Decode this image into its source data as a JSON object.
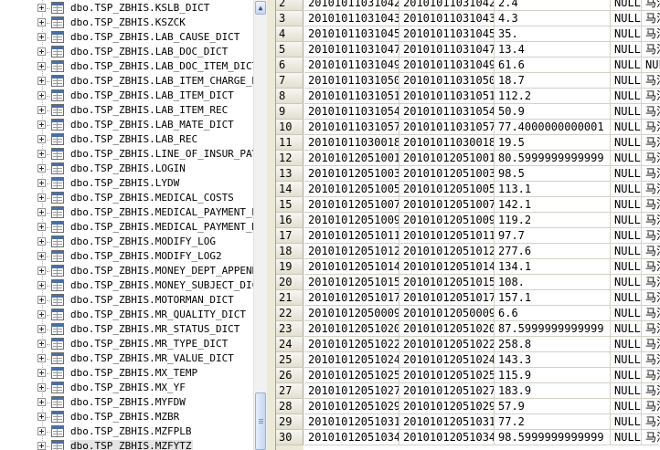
{
  "tree": {
    "items": [
      {
        "label": "dbo.TSP_ZBHIS.KSLB_DICT"
      },
      {
        "label": "dbo.TSP_ZBHIS.KSZCK"
      },
      {
        "label": "dbo.TSP_ZBHIS.LAB_CAUSE_DICT"
      },
      {
        "label": "dbo.TSP_ZBHIS.LAB_DOC_DICT"
      },
      {
        "label": "dbo.TSP_ZBHIS.LAB_DOC_ITEM_DICT"
      },
      {
        "label": "dbo.TSP_ZBHIS.LAB_ITEM_CHARGE_DIC"
      },
      {
        "label": "dbo.TSP_ZBHIS.LAB_ITEM_DICT"
      },
      {
        "label": "dbo.TSP_ZBHIS.LAB_ITEM_REC"
      },
      {
        "label": "dbo.TSP_ZBHIS.LAB_MATE_DICT"
      },
      {
        "label": "dbo.TSP_ZBHIS.LAB_REC"
      },
      {
        "label": "dbo.TSP_ZBHIS.LINE_OF_INSUR_PAYME"
      },
      {
        "label": "dbo.TSP_ZBHIS.LOGIN"
      },
      {
        "label": "dbo.TSP_ZBHIS.LYDW"
      },
      {
        "label": "dbo.TSP_ZBHIS.MEDICAL_COSTS"
      },
      {
        "label": "dbo.TSP_ZBHIS.MEDICAL_PAYMENT_DET"
      },
      {
        "label": "dbo.TSP_ZBHIS.MEDICAL_PAYMENT_MAS"
      },
      {
        "label": "dbo.TSP_ZBHIS.MODIFY_LOG"
      },
      {
        "label": "dbo.TSP_ZBHIS.MODIFY_LOG2"
      },
      {
        "label": "dbo.TSP_ZBHIS.MONEY_DEPT_APPENDED"
      },
      {
        "label": "dbo.TSP_ZBHIS.MONEY_SUBJECT_DICT"
      },
      {
        "label": "dbo.TSP_ZBHIS.MOTORMAN_DICT"
      },
      {
        "label": "dbo.TSP_ZBHIS.MR_QUALITY_DICT"
      },
      {
        "label": "dbo.TSP_ZBHIS.MR_STATUS_DICT"
      },
      {
        "label": "dbo.TSP_ZBHIS.MR_TYPE_DICT"
      },
      {
        "label": "dbo.TSP_ZBHIS.MR_VALUE_DICT"
      },
      {
        "label": "dbo.TSP_ZBHIS.MX_TEMP"
      },
      {
        "label": "dbo.TSP_ZBHIS.MX_YF"
      },
      {
        "label": "dbo.TSP_ZBHIS.MYFDW"
      },
      {
        "label": "dbo.TSP_ZBHIS.MZBR"
      },
      {
        "label": "dbo.TSP_ZBHIS.MZFPLB"
      },
      {
        "label": "dbo.TSP_ZBHIS.MZFYTZ"
      }
    ],
    "selected_index": 30
  },
  "scrollbar": {
    "up_arrow_icon": "chevron-up-icon"
  },
  "grid": {
    "rows": [
      {
        "n": "2",
        "a": "20101011031042",
        "b": "20101011031042",
        "c": "2.4",
        "d": "NULL",
        "e": "马法"
      },
      {
        "n": "3",
        "a": "20101011031043",
        "b": "20101011031043",
        "c": "4.3",
        "d": "NULL",
        "e": "马法"
      },
      {
        "n": "4",
        "a": "20101011031045",
        "b": "20101011031045",
        "c": "35.",
        "d": "NULL",
        "e": "马法"
      },
      {
        "n": "5",
        "a": "20101011031047",
        "b": "20101011031047",
        "c": "13.4",
        "d": "NULL",
        "e": "马法"
      },
      {
        "n": "6",
        "a": "20101011031049",
        "b": "20101011031049",
        "c": "61.6",
        "d": "NULL",
        "e": "NULL"
      },
      {
        "n": "7",
        "a": "20101011031050",
        "b": "20101011031050",
        "c": "18.7",
        "d": "NULL",
        "e": "马法"
      },
      {
        "n": "8",
        "a": "20101011031051",
        "b": "20101011031051",
        "c": "112.2",
        "d": "NULL",
        "e": "马法"
      },
      {
        "n": "9",
        "a": "20101011031054",
        "b": "20101011031054",
        "c": "50.9",
        "d": "NULL",
        "e": "马法"
      },
      {
        "n": "10",
        "a": "20101011031057",
        "b": "20101011031057",
        "c": "77.4000000000001",
        "d": "NULL",
        "e": "马法"
      },
      {
        "n": "11",
        "a": "20101011030018",
        "b": "20101011030018",
        "c": "19.5",
        "d": "NULL",
        "e": "马法"
      },
      {
        "n": "12",
        "a": "20101012051001",
        "b": "20101012051001",
        "c": "80.5999999999999",
        "d": "NULL",
        "e": "马法"
      },
      {
        "n": "13",
        "a": "20101012051003",
        "b": "20101012051003",
        "c": "98.5",
        "d": "NULL",
        "e": "马法"
      },
      {
        "n": "14",
        "a": "20101012051005",
        "b": "20101012051005",
        "c": "113.1",
        "d": "NULL",
        "e": "马法"
      },
      {
        "n": "15",
        "a": "20101012051007",
        "b": "20101012051007",
        "c": "142.1",
        "d": "NULL",
        "e": "马法"
      },
      {
        "n": "16",
        "a": "20101012051009",
        "b": "20101012051009",
        "c": "119.2",
        "d": "NULL",
        "e": "马法"
      },
      {
        "n": "17",
        "a": "20101012051011",
        "b": "20101012051011",
        "c": "97.7",
        "d": "NULL",
        "e": "马法"
      },
      {
        "n": "18",
        "a": "20101012051012",
        "b": "20101012051012",
        "c": "277.6",
        "d": "NULL",
        "e": "马法"
      },
      {
        "n": "19",
        "a": "20101012051014",
        "b": "20101012051014",
        "c": "134.1",
        "d": "NULL",
        "e": "马法"
      },
      {
        "n": "20",
        "a": "20101012051015",
        "b": "20101012051015",
        "c": "108.",
        "d": "NULL",
        "e": "马法"
      },
      {
        "n": "21",
        "a": "20101012051017",
        "b": "20101012051017",
        "c": "157.1",
        "d": "NULL",
        "e": "马法"
      },
      {
        "n": "22",
        "a": "20101012050009",
        "b": "20101012050009",
        "c": "6.6",
        "d": "NULL",
        "e": "马法"
      },
      {
        "n": "23",
        "a": "20101012051020",
        "b": "20101012051020",
        "c": "87.5999999999999",
        "d": "NULL",
        "e": "马法"
      },
      {
        "n": "24",
        "a": "20101012051022",
        "b": "20101012051022",
        "c": "258.8",
        "d": "NULL",
        "e": "马法"
      },
      {
        "n": "25",
        "a": "20101012051024",
        "b": "20101012051024",
        "c": "143.3",
        "d": "NULL",
        "e": "马法"
      },
      {
        "n": "26",
        "a": "20101012051025",
        "b": "20101012051025",
        "c": "115.9",
        "d": "NULL",
        "e": "马法"
      },
      {
        "n": "27",
        "a": "20101012051027",
        "b": "20101012051027",
        "c": "183.9",
        "d": "NULL",
        "e": "马法"
      },
      {
        "n": "28",
        "a": "20101012051029",
        "b": "20101012051029",
        "c": "57.9",
        "d": "NULL",
        "e": "马法"
      },
      {
        "n": "29",
        "a": "20101012051031",
        "b": "20101012051031",
        "c": "77.2",
        "d": "NULL",
        "e": "马法"
      },
      {
        "n": "30",
        "a": "20101012051034",
        "b": "20101012051034",
        "c": "98.5999999999999",
        "d": "NULL",
        "e": "马法"
      }
    ]
  }
}
